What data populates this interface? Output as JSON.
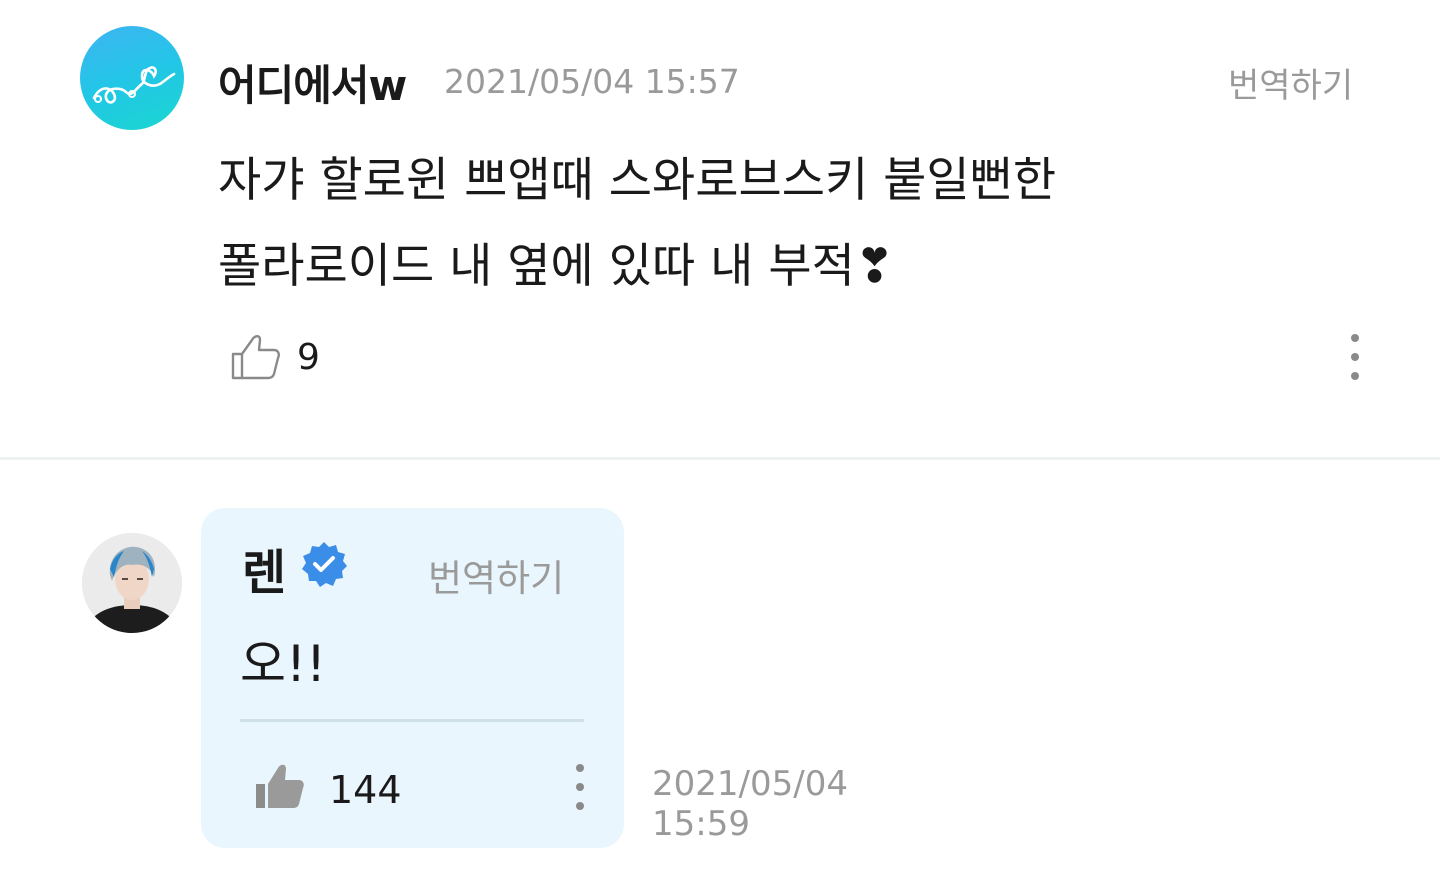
{
  "comment": {
    "username": "어디에서w",
    "date": "2021/05/04 15:57",
    "translate_label": "번역하기",
    "text_line1": "자갸 할로윈 쁘앱때 스와로브스키 붙일뻔한",
    "text_line2": "폴라로이드 내 옆에 있따 내 부적❣",
    "like_count": "9",
    "icons": {
      "like": "thumbs-up-outline-icon",
      "more": "more-vertical-icon"
    }
  },
  "reply": {
    "username": "렌",
    "translate_label": "번역하기",
    "text": "오!!",
    "like_count": "144",
    "date_line1": "2021/05/04",
    "date_line2": "15:59",
    "icons": {
      "like": "thumbs-up-filled-icon",
      "more": "more-vertical-icon",
      "verified": "verified-badge-icon"
    }
  },
  "colors": {
    "bubble_bg": "#eaf6fd",
    "verified_blue": "#3a8ee8",
    "muted_text": "#9a9a9a"
  }
}
